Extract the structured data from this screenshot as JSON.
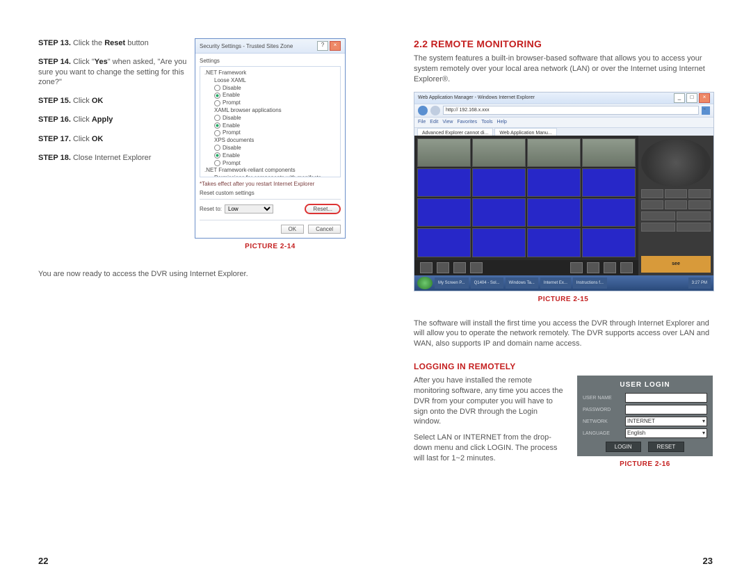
{
  "leftPage": {
    "steps": {
      "s13": {
        "label": "STEP 13.",
        "text": " Click the ",
        "bold": "Reset",
        "text2": " button"
      },
      "s14": {
        "label": "STEP 14.",
        "text": " Click \"",
        "bold": "Yes",
        "text2": "\" when asked, \"Are you sure you want to change the setting for this zone?\""
      },
      "s15": {
        "label": "STEP 15.",
        "text": " Click ",
        "bold": "OK"
      },
      "s16": {
        "label": "STEP 16.",
        "text": " Click ",
        "bold": "Apply"
      },
      "s17": {
        "label": "STEP 17.",
        "text": " Click ",
        "bold": "OK"
      },
      "s18": {
        "label": "STEP 18.",
        "text": " Close Internet Explorer"
      }
    },
    "dialog": {
      "title": "Security Settings - Trusted Sites Zone",
      "settingsLabel": "Settings",
      "items": {
        "net": ".NET Framework",
        "loose": "Loose XAML",
        "disable": "Disable",
        "enable": "Enable",
        "prompt": "Prompt",
        "xaml": "XAML browser applications",
        "xps": "XPS documents",
        "reliant": ".NET Framework-reliant components",
        "perm": "Permissions for components with manifests"
      },
      "note": "*Takes effect after you restart Internet Explorer",
      "resetLabel": "Reset custom settings",
      "resetTo": "Reset to:",
      "resetLevel": "Low",
      "resetBtn": "Reset...",
      "ok": "OK",
      "cancel": "Cancel"
    },
    "pictureLabel": "PICTURE 2-14",
    "readyText": "You are now ready to access the DVR using Internet Explorer.",
    "pageNum": "22"
  },
  "rightPage": {
    "sectionTitle": "2.2 REMOTE MONITORING",
    "intro": "The system features a built-in browser-based software that allows you to access your system remotely over your local area network (LAN) or over the Internet using Internet Explorer®.",
    "browser": {
      "addr": "http://  192.168.x.xxx",
      "tab1": "Advanced Explorer cannot di...",
      "tab2": "Web Application Manu...",
      "logo": "see"
    },
    "pictureLabel15": "PICTURE 2-15",
    "midText": "The software will install the first time you access the DVR through Internet Explorer and will allow you to operate the network remotely. The DVR supports access over LAN and WAN, also supports IP and domain name access.",
    "subTitle": "LOGGING IN REMOTELY",
    "loginText1": "After you have installed the remote monitoring software, any time you acces the DVR from your computer you will have to sign onto the DVR through the Login window.",
    "loginText2": "Select LAN or INTERNET from the drop-down menu and click LOGIN. The process will last for 1~2 minutes.",
    "loginBox": {
      "title": "USER LOGIN",
      "userLabel": "USER NAME",
      "passLabel": "PASSWORD",
      "netLabel": "NETWORK",
      "netValue": "INTERNET",
      "langLabel": "LANGUAGE",
      "langValue": "English",
      "loginBtn": "LOGIN",
      "resetBtn": "RESET"
    },
    "pictureLabel16": "PICTURE 2-16",
    "pageNum": "23"
  }
}
